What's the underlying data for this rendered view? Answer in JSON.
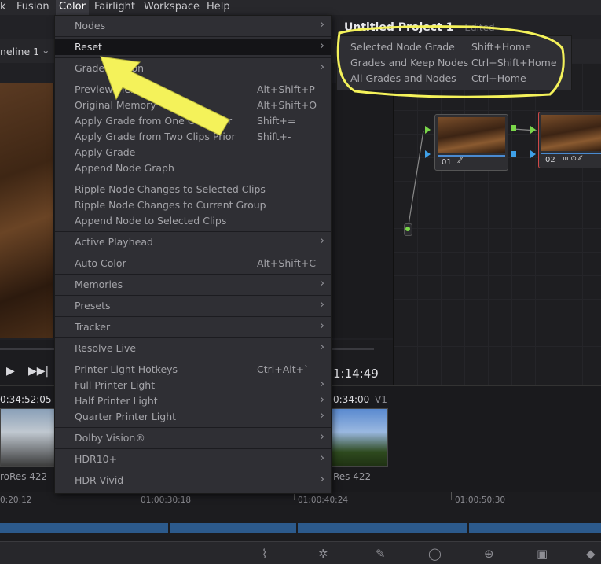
{
  "menubar": {
    "items": [
      "k",
      "Fusion",
      "Color",
      "Fairlight",
      "Workspace",
      "Help"
    ]
  },
  "project": {
    "title": "Untitled Project 1",
    "status": "Edited"
  },
  "timeline_selector": {
    "label": "neline 1"
  },
  "color_menu": {
    "items": [
      {
        "label": "Nodes",
        "shortcut": "",
        "submenu": true
      },
      {
        "label": "Reset",
        "shortcut": "",
        "submenu": true
      },
      {
        "label": "Grade Version",
        "shortcut": "",
        "submenu": true
      },
      {
        "label": "Preview Memory",
        "shortcut": "Alt+Shift+P",
        "submenu": false
      },
      {
        "label": "Original Memory",
        "shortcut": "Alt+Shift+O",
        "submenu": false
      },
      {
        "label": "Apply Grade from One Clip Prior",
        "shortcut": "Shift+=",
        "submenu": false
      },
      {
        "label": "Apply Grade from Two Clips Prior",
        "shortcut": "Shift+-",
        "submenu": false
      },
      {
        "label": "Apply Grade",
        "shortcut": "",
        "submenu": false
      },
      {
        "label": "Append Node Graph",
        "shortcut": "",
        "submenu": false
      },
      {
        "label": "Ripple Node Changes to Selected Clips",
        "shortcut": "",
        "submenu": false
      },
      {
        "label": "Ripple Node Changes to Current Group",
        "shortcut": "",
        "submenu": false
      },
      {
        "label": "Append Node to Selected Clips",
        "shortcut": "",
        "submenu": false
      },
      {
        "label": "Active Playhead",
        "shortcut": "",
        "submenu": true
      },
      {
        "label": "Auto Color",
        "shortcut": "Alt+Shift+C",
        "submenu": false
      },
      {
        "label": "Memories",
        "shortcut": "",
        "submenu": true
      },
      {
        "label": "Presets",
        "shortcut": "",
        "submenu": true
      },
      {
        "label": "Tracker",
        "shortcut": "",
        "submenu": true
      },
      {
        "label": "Resolve Live",
        "shortcut": "",
        "submenu": true
      },
      {
        "label": "Printer Light Hotkeys",
        "shortcut": "Ctrl+Alt+`",
        "submenu": false
      },
      {
        "label": "Full Printer Light",
        "shortcut": "",
        "submenu": true
      },
      {
        "label": "Half Printer Light",
        "shortcut": "",
        "submenu": true
      },
      {
        "label": "Quarter Printer Light",
        "shortcut": "",
        "submenu": true
      },
      {
        "label": "Dolby Vision®",
        "shortcut": "",
        "submenu": true
      },
      {
        "label": "HDR10+",
        "shortcut": "",
        "submenu": true
      },
      {
        "label": "HDR Vivid",
        "shortcut": "",
        "submenu": true
      }
    ]
  },
  "reset_submenu": {
    "items": [
      {
        "label": "Selected Node Grade",
        "shortcut": "Shift+Home"
      },
      {
        "label": "Grades and Keep Nodes",
        "shortcut": "Ctrl+Shift+Home"
      },
      {
        "label": "All Grades and Nodes",
        "shortcut": "Ctrl+Home"
      }
    ]
  },
  "nodes": [
    {
      "label": "01"
    },
    {
      "label": "02"
    }
  ],
  "transport": {
    "timecode": "1:14:49"
  },
  "clips": [
    {
      "timecode": "0:34:52:05",
      "codec": "roRes 422"
    },
    {
      "timecode": "0:34:00",
      "track": "V1",
      "codec": "Res 422"
    }
  ],
  "ruler": {
    "labels": [
      "0:20:12",
      "01:00:30:18",
      "01:00:40:24",
      "01:00:50:30"
    ]
  },
  "colors": {
    "annotation": "#f4f25a",
    "menu_bg": "#2f2f34",
    "node_selected_border": "#d04848",
    "port_green": "#7ad64a",
    "port_blue": "#3fa0e8"
  }
}
